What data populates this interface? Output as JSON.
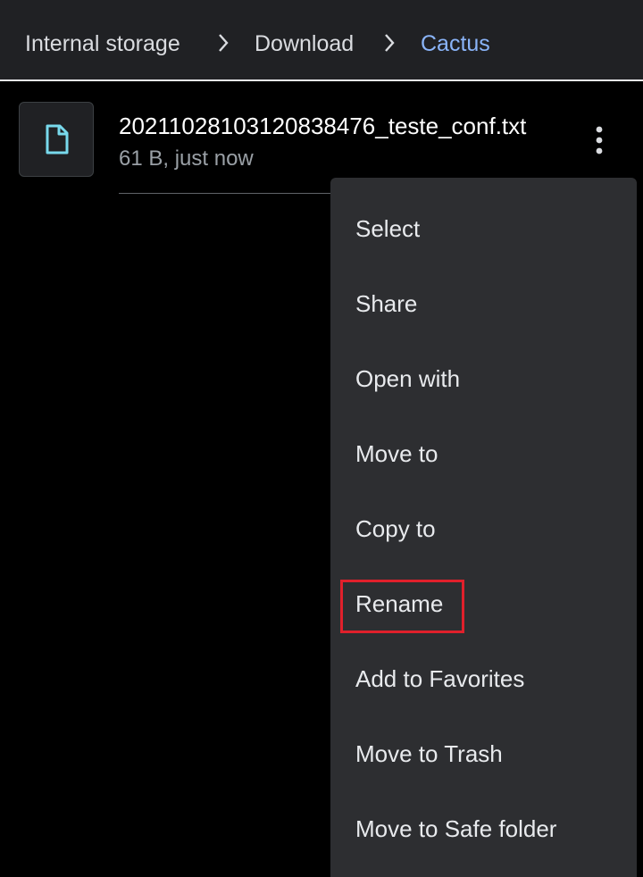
{
  "breadcrumb": {
    "items": [
      {
        "label": "Internal storage"
      },
      {
        "label": "Download"
      },
      {
        "label": "Cactus"
      }
    ]
  },
  "file": {
    "name": "20211028103120838476_teste_conf.txt",
    "meta": "61 B, just now",
    "icon": "file-icon"
  },
  "menu": {
    "items": [
      {
        "label": "Select"
      },
      {
        "label": "Share"
      },
      {
        "label": "Open with"
      },
      {
        "label": "Move to"
      },
      {
        "label": "Copy to"
      },
      {
        "label": "Rename",
        "highlighted": true
      },
      {
        "label": "Add to Favorites"
      },
      {
        "label": "Move to Trash"
      },
      {
        "label": "Move to Safe folder"
      }
    ]
  },
  "colors": {
    "accent": "#8ab4f8",
    "file_icon": "#78d9ec",
    "highlight": "#e0202b",
    "menu_bg": "#2d2e31"
  }
}
